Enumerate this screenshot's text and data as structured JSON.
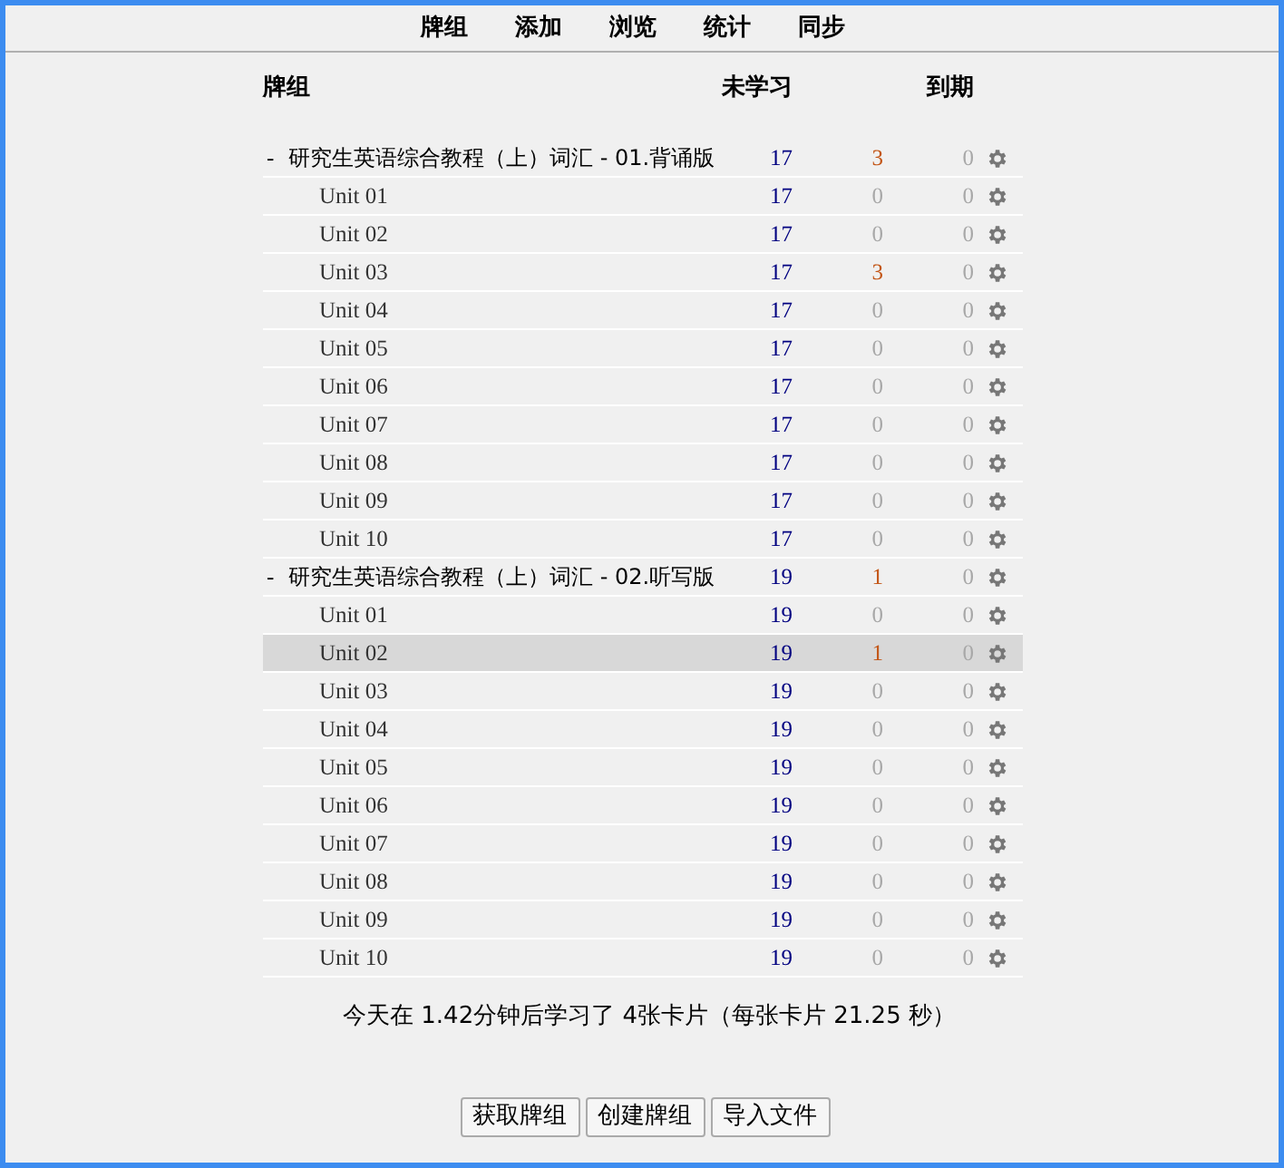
{
  "toolbar": [
    {
      "label": "牌组"
    },
    {
      "label": "添加"
    },
    {
      "label": "浏览"
    },
    {
      "label": "统计"
    },
    {
      "label": "同步"
    }
  ],
  "columns": {
    "deck": "牌组",
    "new": "未学习",
    "due": "到期"
  },
  "decks": [
    {
      "toggle": "-",
      "name": "研究生英语综合教程（上）词汇 - 01.背诵版",
      "selected": false,
      "new": {
        "text": "17",
        "active": true
      },
      "learn": {
        "text": "3",
        "active": true
      },
      "due": {
        "text": "0",
        "active": false
      },
      "children": [
        {
          "name": "Unit 01",
          "selected": false,
          "new": {
            "text": "17",
            "active": true
          },
          "learn": {
            "text": "0",
            "active": false
          },
          "due": {
            "text": "0",
            "active": false
          }
        },
        {
          "name": "Unit 02",
          "selected": false,
          "new": {
            "text": "17",
            "active": true
          },
          "learn": {
            "text": "0",
            "active": false
          },
          "due": {
            "text": "0",
            "active": false
          }
        },
        {
          "name": "Unit 03",
          "selected": false,
          "new": {
            "text": "17",
            "active": true
          },
          "learn": {
            "text": "3",
            "active": true
          },
          "due": {
            "text": "0",
            "active": false
          }
        },
        {
          "name": "Unit 04",
          "selected": false,
          "new": {
            "text": "17",
            "active": true
          },
          "learn": {
            "text": "0",
            "active": false
          },
          "due": {
            "text": "0",
            "active": false
          }
        },
        {
          "name": "Unit 05",
          "selected": false,
          "new": {
            "text": "17",
            "active": true
          },
          "learn": {
            "text": "0",
            "active": false
          },
          "due": {
            "text": "0",
            "active": false
          }
        },
        {
          "name": "Unit 06",
          "selected": false,
          "new": {
            "text": "17",
            "active": true
          },
          "learn": {
            "text": "0",
            "active": false
          },
          "due": {
            "text": "0",
            "active": false
          }
        },
        {
          "name": "Unit 07",
          "selected": false,
          "new": {
            "text": "17",
            "active": true
          },
          "learn": {
            "text": "0",
            "active": false
          },
          "due": {
            "text": "0",
            "active": false
          }
        },
        {
          "name": "Unit 08",
          "selected": false,
          "new": {
            "text": "17",
            "active": true
          },
          "learn": {
            "text": "0",
            "active": false
          },
          "due": {
            "text": "0",
            "active": false
          }
        },
        {
          "name": "Unit 09",
          "selected": false,
          "new": {
            "text": "17",
            "active": true
          },
          "learn": {
            "text": "0",
            "active": false
          },
          "due": {
            "text": "0",
            "active": false
          }
        },
        {
          "name": "Unit 10",
          "selected": false,
          "new": {
            "text": "17",
            "active": true
          },
          "learn": {
            "text": "0",
            "active": false
          },
          "due": {
            "text": "0",
            "active": false
          }
        }
      ]
    },
    {
      "toggle": "-",
      "name": "研究生英语综合教程（上）词汇 - 02.听写版",
      "selected": false,
      "new": {
        "text": "19",
        "active": true
      },
      "learn": {
        "text": "1",
        "active": true
      },
      "due": {
        "text": "0",
        "active": false
      },
      "children": [
        {
          "name": "Unit 01",
          "selected": false,
          "new": {
            "text": "19",
            "active": true
          },
          "learn": {
            "text": "0",
            "active": false
          },
          "due": {
            "text": "0",
            "active": false
          }
        },
        {
          "name": "Unit 02",
          "selected": true,
          "new": {
            "text": "19",
            "active": true
          },
          "learn": {
            "text": "1",
            "active": true
          },
          "due": {
            "text": "0",
            "active": false
          }
        },
        {
          "name": "Unit 03",
          "selected": false,
          "new": {
            "text": "19",
            "active": true
          },
          "learn": {
            "text": "0",
            "active": false
          },
          "due": {
            "text": "0",
            "active": false
          }
        },
        {
          "name": "Unit 04",
          "selected": false,
          "new": {
            "text": "19",
            "active": true
          },
          "learn": {
            "text": "0",
            "active": false
          },
          "due": {
            "text": "0",
            "active": false
          }
        },
        {
          "name": "Unit 05",
          "selected": false,
          "new": {
            "text": "19",
            "active": true
          },
          "learn": {
            "text": "0",
            "active": false
          },
          "due": {
            "text": "0",
            "active": false
          }
        },
        {
          "name": "Unit 06",
          "selected": false,
          "new": {
            "text": "19",
            "active": true
          },
          "learn": {
            "text": "0",
            "active": false
          },
          "due": {
            "text": "0",
            "active": false
          }
        },
        {
          "name": "Unit 07",
          "selected": false,
          "new": {
            "text": "19",
            "active": true
          },
          "learn": {
            "text": "0",
            "active": false
          },
          "due": {
            "text": "0",
            "active": false
          }
        },
        {
          "name": "Unit 08",
          "selected": false,
          "new": {
            "text": "19",
            "active": true
          },
          "learn": {
            "text": "0",
            "active": false
          },
          "due": {
            "text": "0",
            "active": false
          }
        },
        {
          "name": "Unit 09",
          "selected": false,
          "new": {
            "text": "19",
            "active": true
          },
          "learn": {
            "text": "0",
            "active": false
          },
          "due": {
            "text": "0",
            "active": false
          }
        },
        {
          "name": "Unit 10",
          "selected": false,
          "new": {
            "text": "19",
            "active": true
          },
          "learn": {
            "text": "0",
            "active": false
          },
          "due": {
            "text": "0",
            "active": false
          }
        }
      ]
    }
  ],
  "summary": "今天在 1.42分钟后学习了 4张卡片（每张卡片 21.25 秒）",
  "buttons": [
    {
      "label": "获取牌组"
    },
    {
      "label": "创建牌组"
    },
    {
      "label": "导入文件"
    }
  ]
}
